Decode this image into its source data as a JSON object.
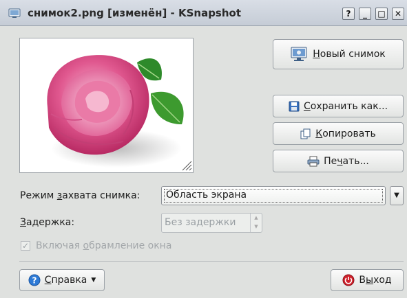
{
  "window": {
    "title": "снимок2.png [изменён] - KSnapshot",
    "controls": {
      "help": "?",
      "minimize": "_",
      "maximize": "□",
      "close": "✕"
    }
  },
  "actions": {
    "new_snapshot": {
      "mnemonic": "Н",
      "rest": "овый снимок"
    },
    "save_as": {
      "mnemonic": "С",
      "rest": "охранить как..."
    },
    "copy": {
      "mnemonic": "К",
      "rest": "опировать"
    },
    "print": {
      "before": "Пе",
      "mnemonic": "ч",
      "after": "ать..."
    }
  },
  "capture_mode": {
    "label_before": "Режим ",
    "label_mnemonic": "з",
    "label_after": "ахвата снимка:",
    "value": "Область экрана"
  },
  "delay": {
    "label_mnemonic": "З",
    "label_rest": "адержка:",
    "value": "Без задержки"
  },
  "include_decorations": {
    "label_before": "Включая ",
    "label_mnemonic": "о",
    "label_after": "брамление окна",
    "checked": true
  },
  "help_button": {
    "mnemonic": "С",
    "rest": "правка"
  },
  "quit_button": {
    "before": "В",
    "mnemonic": "ы",
    "after": "ход"
  },
  "colors": {
    "background": "#dfe1df",
    "titlebar": "#c9d0d8",
    "help_icon": "#2d7ad6",
    "quit_icon": "#d0202a"
  }
}
